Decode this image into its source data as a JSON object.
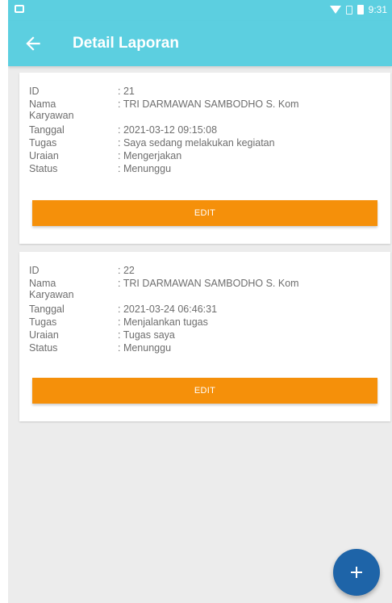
{
  "app_bar": {
    "title": "Detail Laporan"
  },
  "status_bar": {
    "time": "9:31"
  },
  "reports": [
    {
      "id_label": "ID",
      "id_value": ": 21",
      "nama_label_1": "Nama",
      "nama_label_2": "Karyawan",
      "nama_value": ": TRI DARMAWAN SAMBODHO S. Kom",
      "tanggal_label": "Tanggal",
      "tanggal_value": ": 2021-03-12 09:15:08",
      "tugas_label": "Tugas",
      "tugas_value": ": Saya sedang melakukan kegiatan",
      "uraian_label": "Uraian",
      "uraian_value": ": Mengerjakan",
      "status_label": "Status",
      "status_value": ": Menunggu",
      "edit_label": "EDIT"
    },
    {
      "id_label": "ID",
      "id_value": ": 22",
      "nama_label_1": "Nama",
      "nama_label_2": "Karyawan",
      "nama_value": ": TRI DARMAWAN SAMBODHO S. Kom",
      "tanggal_label": "Tanggal",
      "tanggal_value": ": 2021-03-24 06:46:31",
      "tugas_label": "Tugas",
      "tugas_value": ": Menjalankan tugas",
      "uraian_label": "Uraian",
      "uraian_value": ": Tugas saya",
      "status_label": "Status",
      "status_value": ": Menunggu",
      "edit_label": "EDIT"
    }
  ],
  "fab": {
    "icon": "plus-icon"
  },
  "colors": {
    "app_bar": "#5ccfe0",
    "edit_button": "#f5900a",
    "fab": "#1e64a8",
    "background": "#ececec"
  }
}
